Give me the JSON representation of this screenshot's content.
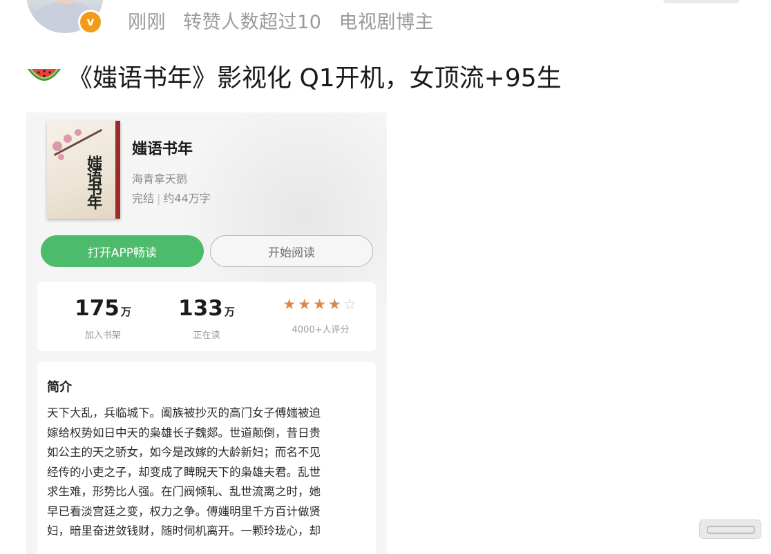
{
  "post": {
    "time": "刚刚",
    "repost_note": "转赞人数超过10",
    "author_tag": "电视剧博主",
    "verified_badge": "v",
    "text": "《媸语书年》影视化 Q1开机，女顶流+95生"
  },
  "book_card": {
    "title": "媸语书年",
    "author": "海青拿天鹅",
    "status": "完结",
    "word_count": "约44万字",
    "cover_text": "媸语书年",
    "buttons": {
      "open_app": "打开APP畅读",
      "start_reading": "开始阅读"
    },
    "stats": [
      {
        "value": "175",
        "unit": "万",
        "label": "加入书架"
      },
      {
        "value": "133",
        "unit": "万",
        "label": "正在读"
      }
    ],
    "rating": {
      "stars_filled": 4,
      "stars_total": 5,
      "label": "4000+人评分"
    },
    "intro": {
      "heading": "简介",
      "lines": [
        "天下大乱，兵临城下。阖族被抄灭的高门女子傅媸被迫",
        "嫁给权势如日中天的枭雄长子魏郯。世道颠倒，昔日贵",
        "如公主的天之骄女，如今是改嫁的大龄新妇；而名不见",
        "经传的小吏之子，却变成了睥睨天下的枭雄夫君。乱世",
        "求生难，形势比人强。在门阀倾轧、乱世流离之时，她",
        "早已看淡宫廷之变，权力之争。傅媸明里千方百计做贤",
        "妇，暗里奋进敛钱财，随时伺机离开。一颗玲珑心，却"
      ]
    }
  },
  "colors": {
    "accent_green": "#4cbb6b",
    "star_orange": "#d9874a",
    "badge_orange": "#f29b18",
    "meta_gray": "#9a9a9a"
  }
}
